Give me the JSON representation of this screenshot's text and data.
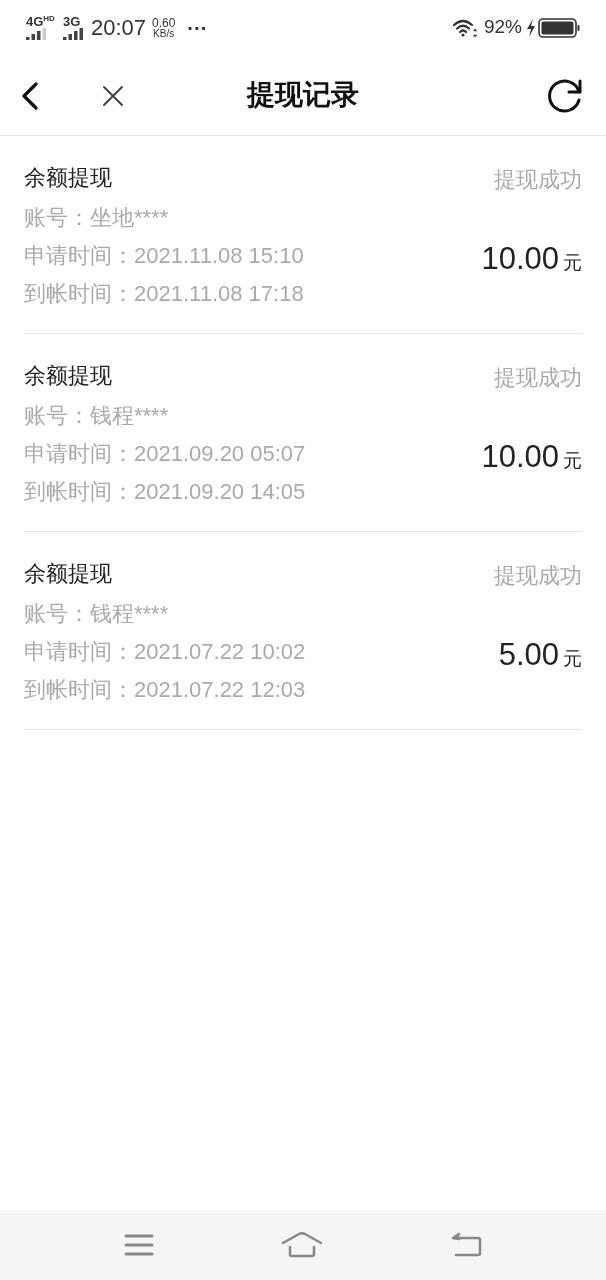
{
  "status_bar": {
    "network_1": "4G",
    "network_1_badge": "HD",
    "network_2": "3G",
    "time": "20:07",
    "speed_value": "0.60",
    "speed_unit": "KB/s",
    "more": "···",
    "battery": "92%"
  },
  "header": {
    "title": "提现记录"
  },
  "records": [
    {
      "type": "余额提现",
      "status": "提现成功",
      "account": "账号：坐地****",
      "applied": "申请时间：2021.11.08 15:10",
      "arrived": "到帐时间：2021.11.08 17:18",
      "amount": "10.00",
      "unit": "元"
    },
    {
      "type": "余额提现",
      "status": "提现成功",
      "account": "账号：钱程****",
      "applied": "申请时间：2021.09.20 05:07",
      "arrived": "到帐时间：2021.09.20 14:05",
      "amount": "10.00",
      "unit": "元"
    },
    {
      "type": "余额提现",
      "status": "提现成功",
      "account": "账号：钱程****",
      "applied": "申请时间：2021.07.22 10:02",
      "arrived": "到帐时间：2021.07.22 12:03",
      "amount": "5.00",
      "unit": "元"
    }
  ]
}
